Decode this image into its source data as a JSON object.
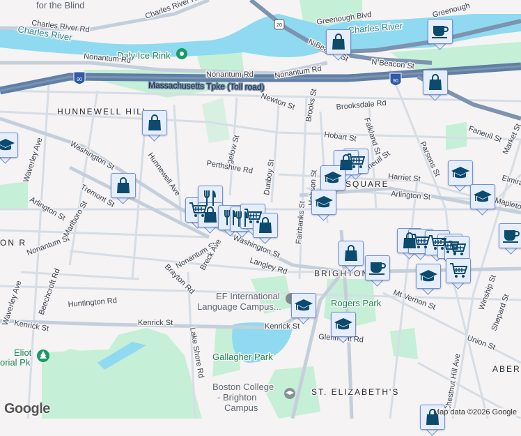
{
  "map": {
    "attribution": "Map data ©2026 Google",
    "logo": "Google",
    "colors": {
      "land": "#f5f3f3",
      "water": "#8fdaf0",
      "park": "#c5efd6",
      "highway": "#5f7fa6",
      "road": "#d6dde5",
      "marker_bg": "#e6edfb",
      "marker_icon": "#0c4a6e"
    }
  },
  "labels": {
    "for_the_blind": "for the Blind",
    "charles_river_rd_1": "Charles River Rd",
    "charles_river_rd_2": "Charles River Rd",
    "charles_river_1": "Charles River",
    "charles_river_2": "Charles River",
    "daly_ice_rink": "Daly Ice Rink",
    "nonantum_rd_1": "Nonantum Rd",
    "nonantum_rd_2": "Nonantum Rd",
    "nonantum_rd_3": "Nonantum Rd",
    "mass_pike": "Massachusetts Tpke (Toll road)",
    "i90_a": "90",
    "i90_b": "90",
    "us20": "20",
    "hunnewell_hill": "HUNNEWELL HILL",
    "washington_st_1": "Washington St",
    "washington_st_2": "Washington St",
    "tremont_st": "Tremont St",
    "waverley_ave_1": "Waverley Ave",
    "waverley_ave_2": "Waverley Ave",
    "arlington_st_1": "Arlington St",
    "arlington_st_2": "Arlington St",
    "hunnewell_ave": "Hunnewell Ave",
    "bigelow_st": "Bigelow St",
    "perthshire_rd": "Perthshire Rd",
    "dunboy_st": "Dunboy St",
    "newton_st": "Newton St",
    "brooks_st": "Brooks St",
    "brooksdale_rd": "Brooksdale Rd",
    "hobart_st": "Hobart St",
    "faneuil_st_1": "Faneuil St",
    "faneuil_st_2": "Faneuil St",
    "falkland_st": "Falkland St",
    "parsons_st": "Parsons St",
    "market_st": "Market St",
    "harriet_st": "Harriet St",
    "square": "SQUARE",
    "elmira": "Elmira",
    "mapleton": "Mapleton",
    "hobson_st": "Hobson St",
    "greenough_blvd": "Greenough Blvd",
    "greenough": "Greenough",
    "n_beacon_st_1": "N Beacon St",
    "n_beacon_st_2": "N Beacon St",
    "fairbanks_st": "Fairbanks St",
    "langley_rd": "Langley Rd",
    "nonantum_st_1": "Nonantum St",
    "nonantum_st_2": "Nonantum St",
    "marlboro_st": "Marlboro St",
    "breck_ave": "Breck Ave",
    "brayton_rd": "Brayton Rd",
    "brighton": "BRIGHTON",
    "ef_campus_1": "EF International",
    "ef_campus_2": "Language Campus...",
    "huntington_rd": "Huntington Rd",
    "beechcroft_rd": "Beechcroft Rd",
    "kenrick_st_1": "Kenrick St",
    "kenrick_st_2": "Kenrick St",
    "kenrick_st_3": "Kenrick St",
    "lake_shore_rd": "Lake Shore Rd",
    "gallagher_park": "Gallagher Park",
    "eliot_pk_1": "Eliot",
    "eliot_pk_2": "orial Pk",
    "bc_1": "Boston College",
    "bc_2": "- Brighton",
    "bc_3": "Campus",
    "rogers_park": "Rogers Park",
    "mt_vernon_st": "Mt Vernon St",
    "glenmont_rd": "Glenmont Rd",
    "st_elizabeths": "ST. ELIZABETH'S",
    "chestnut_hill_ave": "Chestnut Hill Ave",
    "union_st": "Union St",
    "winship_st": "Winship St",
    "shepard_st": "Shepard St",
    "aberd": "ABERD",
    "on_r": "ON R"
  },
  "markers": [
    {
      "type": "education"
    },
    {
      "type": "shopping"
    },
    {
      "type": "shopping"
    },
    {
      "type": "grocery"
    },
    {
      "type": "restaurant"
    },
    {
      "type": "shopping"
    },
    {
      "type": "restaurant"
    },
    {
      "type": "restaurant"
    },
    {
      "type": "grocery"
    },
    {
      "type": "shopping"
    },
    {
      "type": "shopping"
    },
    {
      "type": "cafe"
    },
    {
      "type": "shopping"
    },
    {
      "type": "grocery"
    },
    {
      "type": "shopping"
    },
    {
      "type": "education"
    },
    {
      "type": "education"
    },
    {
      "type": "education"
    },
    {
      "type": "education"
    },
    {
      "type": "cafe"
    },
    {
      "type": "shopping"
    },
    {
      "type": "cafe"
    },
    {
      "type": "shopping"
    },
    {
      "type": "grocery"
    },
    {
      "type": "grocery"
    },
    {
      "type": "grocery"
    },
    {
      "type": "grocery"
    },
    {
      "type": "grocery"
    },
    {
      "type": "education"
    },
    {
      "type": "education"
    },
    {
      "type": "education"
    },
    {
      "type": "shopping"
    }
  ]
}
